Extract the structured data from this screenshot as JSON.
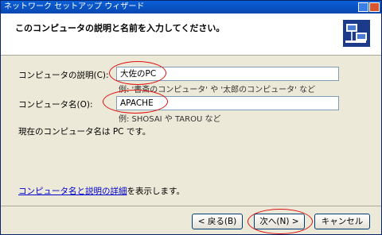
{
  "window": {
    "title": "ネットワーク セットアップ ウィザード"
  },
  "header": {
    "title": "このコンピュータの説明と名前を入力してください。",
    "icon": "network-computers-icon"
  },
  "form": {
    "description_label": "コンピュータの説明(C):",
    "description_value": "大佐のPC",
    "description_hint": "例: '書斎のコンピュータ' や '太郎のコンピュータ' など",
    "name_label": "コンピュータ名(O):",
    "name_value": "APACHE",
    "name_hint": "例: SHOSAI や TAROU など",
    "current_name_text": "現在のコンピュータ名は PC です。"
  },
  "details": {
    "link_text": "コンピュータ名と説明の詳細",
    "suffix_text": "を表示します。"
  },
  "footer": {
    "back_label": "< 戻る(B)",
    "next_label": "次へ(N) >",
    "cancel_label": "キャンセル"
  },
  "colors": {
    "annotation": "#dd1111",
    "titlebar": "#0a5fd8",
    "dialog_bg": "#ece9d8"
  }
}
